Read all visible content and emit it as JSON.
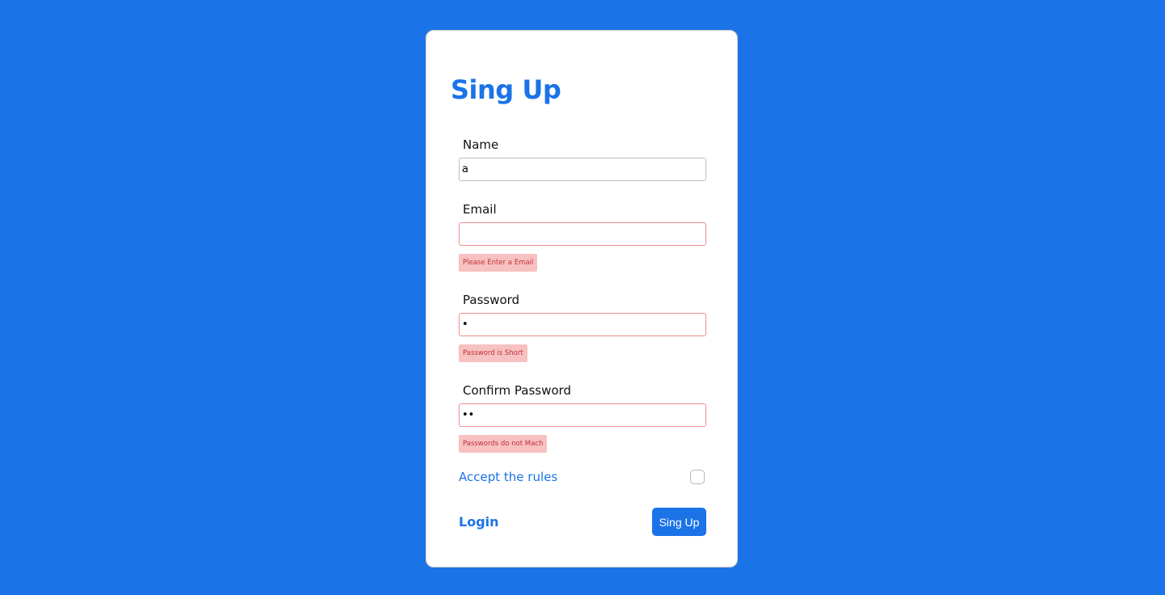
{
  "form": {
    "title": "Sing Up",
    "fields": [
      {
        "label": "Name",
        "value": "a",
        "type": "text",
        "error": null
      },
      {
        "label": "Email",
        "value": "",
        "type": "email",
        "error": "Please Enter a Email"
      },
      {
        "label": "Password",
        "value": "1",
        "type": "password",
        "error": "Password is Short"
      },
      {
        "label": "Confirm Password",
        "value": "12",
        "type": "password",
        "error": "Passwords do not Mach"
      }
    ],
    "accept_rules_label": "Accept the rules",
    "accept_rules_checked": false,
    "login_link": "Login",
    "submit_label": "Sing Up"
  },
  "colors": {
    "background": "#1b73e8",
    "accent": "#1b73e8",
    "error_bg": "#f7c1c1",
    "error_text": "#c0303a",
    "error_border": "#ee8d8d"
  }
}
